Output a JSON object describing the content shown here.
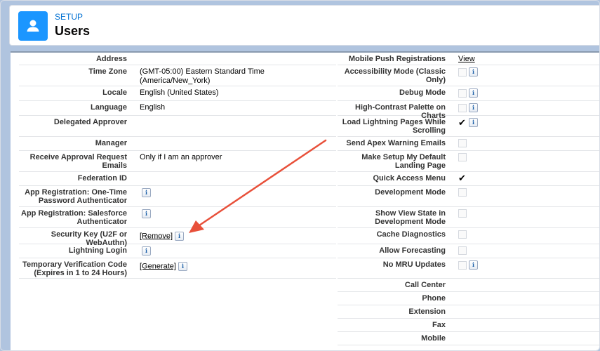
{
  "header": {
    "eyebrow": "SETUP",
    "title": "Users"
  },
  "left_rows": [
    {
      "label": "Address",
      "value": ""
    },
    {
      "label": "Time Zone",
      "value": "(GMT-05:00) Eastern Standard Time (America/New_York)"
    },
    {
      "label": "Locale",
      "value": "English (United States)"
    },
    {
      "label": "Language",
      "value": "English"
    },
    {
      "label": "Delegated Approver",
      "value": ""
    },
    {
      "label": "Manager",
      "value": ""
    },
    {
      "label": "Receive Approval Request Emails",
      "value": "Only if I am an approver"
    },
    {
      "label": "Federation ID",
      "value": ""
    },
    {
      "label": "App Registration: One-Time Password Authenticator",
      "value": ""
    },
    {
      "label": "App Registration: Salesforce Authenticator",
      "value": ""
    },
    {
      "label": "Security Key (U2F or WebAuthn)",
      "value": "[Remove]"
    },
    {
      "label": "Lightning Login",
      "value": ""
    },
    {
      "label": "Temporary Verification Code (Expires in 1 to 24 Hours)",
      "value": "[Generate]"
    }
  ],
  "right_rows": [
    {
      "label": "Mobile Push Registrations",
      "value": "View"
    },
    {
      "label": "Accessibility Mode (Classic Only)",
      "checked": false
    },
    {
      "label": "Debug Mode",
      "checked": false
    },
    {
      "label": "High-Contrast Palette on Charts",
      "checked": false
    },
    {
      "label": "Load Lightning Pages While Scrolling",
      "checked": true
    },
    {
      "label": "Send Apex Warning Emails",
      "checked": false
    },
    {
      "label": "Make Setup My Default Landing Page",
      "checked": false
    },
    {
      "label": "Quick Access Menu",
      "checked": true
    },
    {
      "label": "Development Mode",
      "checked": false
    },
    {
      "label": "Show View State in Development Mode",
      "checked": false
    },
    {
      "label": "Cache Diagnostics",
      "checked": false
    },
    {
      "label": "Allow Forecasting",
      "checked": false
    },
    {
      "label": "No MRU Updates",
      "checked": false
    },
    {
      "label": "Call Center",
      "value": ""
    },
    {
      "label": "Phone",
      "value": ""
    },
    {
      "label": "Extension",
      "value": ""
    },
    {
      "label": "Fax",
      "value": ""
    },
    {
      "label": "Mobile",
      "value": ""
    }
  ],
  "icons": {
    "info": "info-icon",
    "user": "user-icon",
    "check": "checkmark-icon"
  },
  "colors": {
    "brand": "#1b96ff",
    "eyebrow": "#0070d2",
    "annotation_arrow": "#e8503a",
    "backdrop": "#b0c4df"
  }
}
